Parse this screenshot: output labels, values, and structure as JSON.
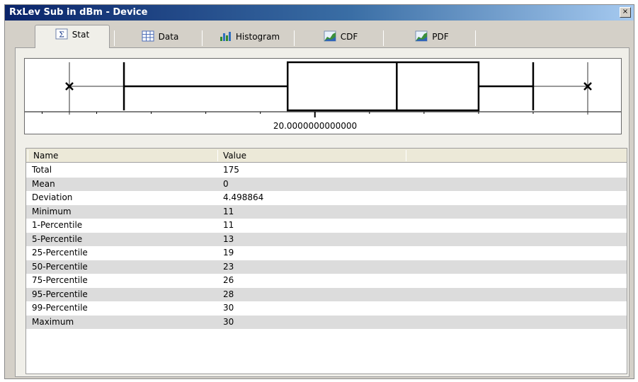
{
  "window": {
    "title": "RxLev Sub in dBm - Device",
    "close_glyph": "×"
  },
  "tabs": [
    {
      "label": "Stat",
      "icon": "sigma-icon",
      "active": true
    },
    {
      "label": "Data",
      "icon": "grid-icon",
      "active": false
    },
    {
      "label": "Histogram",
      "icon": "histogram-icon",
      "active": false
    },
    {
      "label": "CDF",
      "icon": "area-chart-icon",
      "active": false
    },
    {
      "label": "PDF",
      "icon": "area-chart-icon",
      "active": false
    }
  ],
  "boxplot": {
    "axis_label": "20.0000000000000",
    "stats": {
      "min": 11,
      "p1": 11,
      "p5": 13,
      "p25": 19,
      "p50": 23,
      "p75": 26,
      "p95": 28,
      "p99": 30,
      "max": 30
    }
  },
  "table": {
    "columns": [
      "Name",
      "Value"
    ],
    "rows": [
      {
        "name": "Total",
        "value": "175"
      },
      {
        "name": "Mean",
        "value": "0"
      },
      {
        "name": "Deviation",
        "value": "4.498864"
      },
      {
        "name": "Minimum",
        "value": "11"
      },
      {
        "name": "1-Percentile",
        "value": "11"
      },
      {
        "name": "5-Percentile",
        "value": "13"
      },
      {
        "name": "25-Percentile",
        "value": "19"
      },
      {
        "name": "50-Percentile",
        "value": "23"
      },
      {
        "name": "75-Percentile",
        "value": "26"
      },
      {
        "name": "95-Percentile",
        "value": "28"
      },
      {
        "name": "99-Percentile",
        "value": "30"
      },
      {
        "name": "Maximum",
        "value": "30"
      }
    ]
  }
}
